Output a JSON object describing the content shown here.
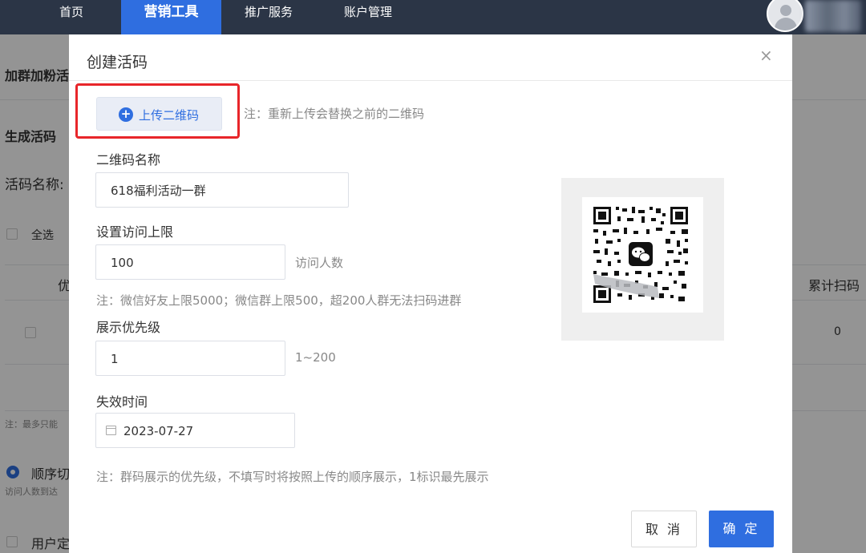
{
  "nav": {
    "items": [
      "首页",
      "营销工具",
      "推广服务",
      "账户管理"
    ],
    "active_index": 1
  },
  "background": {
    "section_title": "加群加粉活",
    "generate_title": "生成活码",
    "code_name_label": "活码名称:",
    "select_all": "全选",
    "col_priority": "优",
    "col_total_scans": "累计扫码",
    "total_scans_value": "0",
    "note_max": "注：最多只能",
    "sequence_label": "顺序切",
    "sequence_note": "访问人数到达",
    "user_label": "用户定"
  },
  "modal": {
    "title": "创建活码",
    "close_icon": "close-icon",
    "upload_button": "上传二维码",
    "upload_note": "注：重新上传会替换之前的二维码",
    "qr_name_label": "二维码名称",
    "qr_name_value": "618福利活动一群",
    "visit_limit_label": "设置访问上限",
    "visit_limit_value": "100",
    "visit_limit_suffix": "访问人数",
    "visit_limit_note": "注：微信好友上限5000；微信群上限500，超200人群无法扫码进群",
    "priority_label": "展示优先级",
    "priority_value": "1",
    "priority_range": "1~200",
    "expire_label": "失效时间",
    "expire_value": "2023-07-27",
    "priority_note": "注：群码展示的优先级，不填写时将按照上传的顺序展示，1标识最先展示",
    "cancel_button": "取 消",
    "confirm_button": "确 定",
    "highlight_color": "#e8262a",
    "accent_color": "#2f6ee0"
  }
}
